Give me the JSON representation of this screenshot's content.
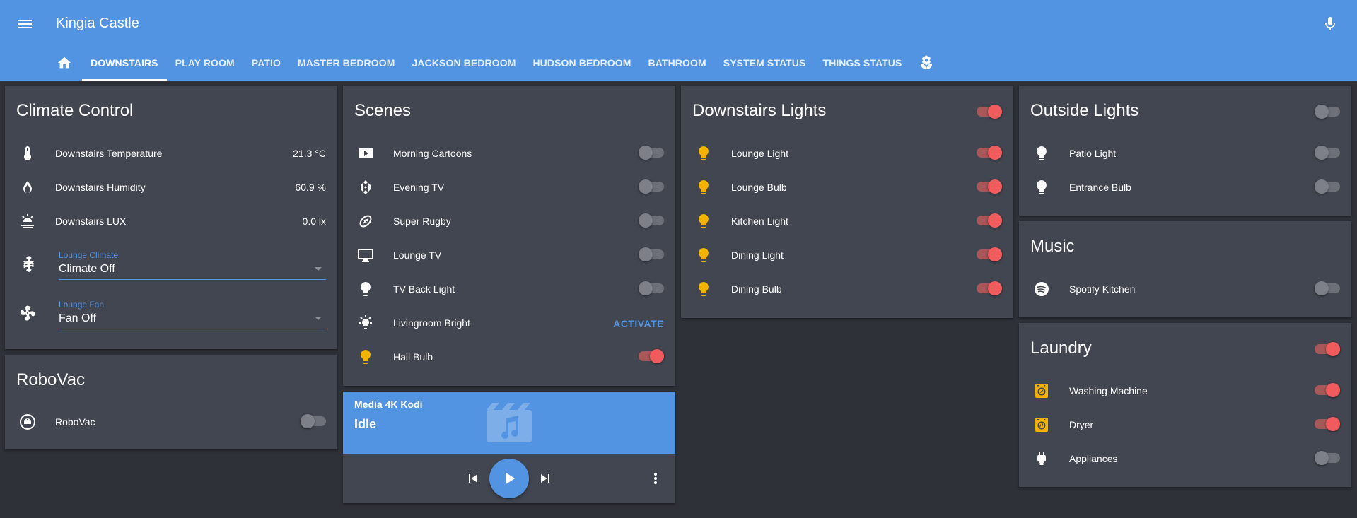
{
  "header": {
    "title": "Kingia Castle",
    "tabs": [
      {
        "label": "DOWNSTAIRS",
        "active": true
      },
      {
        "label": "PLAY ROOM"
      },
      {
        "label": "PATIO"
      },
      {
        "label": "MASTER BEDROOM"
      },
      {
        "label": "JACKSON BEDROOM"
      },
      {
        "label": "HUDSON BEDROOM"
      },
      {
        "label": "BATHROOM"
      },
      {
        "label": "SYSTEM STATUS"
      },
      {
        "label": "THINGS STATUS"
      }
    ],
    "icons": [
      "menu-icon",
      "home-icon",
      "flower-icon",
      "microphone-icon"
    ]
  },
  "colors": {
    "header": "#5294e2",
    "card": "#424650",
    "background": "#2e3138",
    "toggle_on": "#f05b5e",
    "light_on_icon": "#f2b400"
  },
  "climate": {
    "title": "Climate Control",
    "rows": [
      {
        "label": "Downstairs Temperature",
        "value": "21.3 °C",
        "icon": "thermometer-icon"
      },
      {
        "label": "Downstairs Humidity",
        "value": "60.9 %",
        "icon": "water-percent-icon"
      },
      {
        "label": "Downstairs LUX",
        "value": "0.0 lx",
        "icon": "sun-lux-icon"
      }
    ],
    "climate_select": {
      "label": "Lounge Climate",
      "value": "Climate Off",
      "icon": "snowflake-icon"
    },
    "fan_select": {
      "label": "Lounge Fan",
      "value": "Fan Off",
      "icon": "fan-icon"
    }
  },
  "robovac": {
    "title": "RoboVac",
    "rows": [
      {
        "label": "RoboVac",
        "on": false,
        "icon": "robot-vacuum-icon"
      }
    ]
  },
  "scenes": {
    "title": "Scenes",
    "rows": [
      {
        "label": "Morning Cartoons",
        "on": false,
        "icon": "youtube-icon"
      },
      {
        "label": "Evening TV",
        "on": false,
        "icon": "kodi-icon"
      },
      {
        "label": "Super Rugby",
        "on": false,
        "icon": "rugby-icon"
      },
      {
        "label": "Lounge TV",
        "on": false,
        "icon": "monitor-icon"
      },
      {
        "label": "TV Back Light",
        "on": false,
        "icon": "lightbulb-icon"
      },
      {
        "label": "Livingroom Bright",
        "action": "ACTIVATE",
        "icon": "lightbulb-bright-icon"
      },
      {
        "label": "Hall Bulb",
        "on": true,
        "icon": "lightbulb-icon"
      }
    ]
  },
  "media": {
    "name": "Media 4K Kodi",
    "state": "Idle",
    "icons": [
      "movie-music-icon",
      "skip-previous-icon",
      "play-icon",
      "skip-next-icon",
      "more-vertical-icon"
    ]
  },
  "downstairs_lights": {
    "title": "Downstairs Lights",
    "all_on": true,
    "rows": [
      {
        "label": "Lounge Light",
        "on": true
      },
      {
        "label": "Lounge Bulb",
        "on": true
      },
      {
        "label": "Kitchen Light",
        "on": true
      },
      {
        "label": "Dining Light",
        "on": true
      },
      {
        "label": "Dining Bulb",
        "on": true
      }
    ]
  },
  "outside_lights": {
    "title": "Outside Lights",
    "all_on": false,
    "rows": [
      {
        "label": "Patio Light",
        "on": false
      },
      {
        "label": "Entrance Bulb",
        "on": false
      }
    ]
  },
  "music": {
    "title": "Music",
    "rows": [
      {
        "label": "Spotify Kitchen",
        "on": false,
        "icon": "spotify-icon"
      }
    ]
  },
  "laundry": {
    "title": "Laundry",
    "all_on": true,
    "rows": [
      {
        "label": "Washing Machine",
        "on": true,
        "icon": "washing-machine-icon"
      },
      {
        "label": "Dryer",
        "on": true,
        "icon": "tumble-dryer-icon"
      },
      {
        "label": "Appliances",
        "on": false,
        "icon": "power-plug-icon"
      }
    ]
  }
}
